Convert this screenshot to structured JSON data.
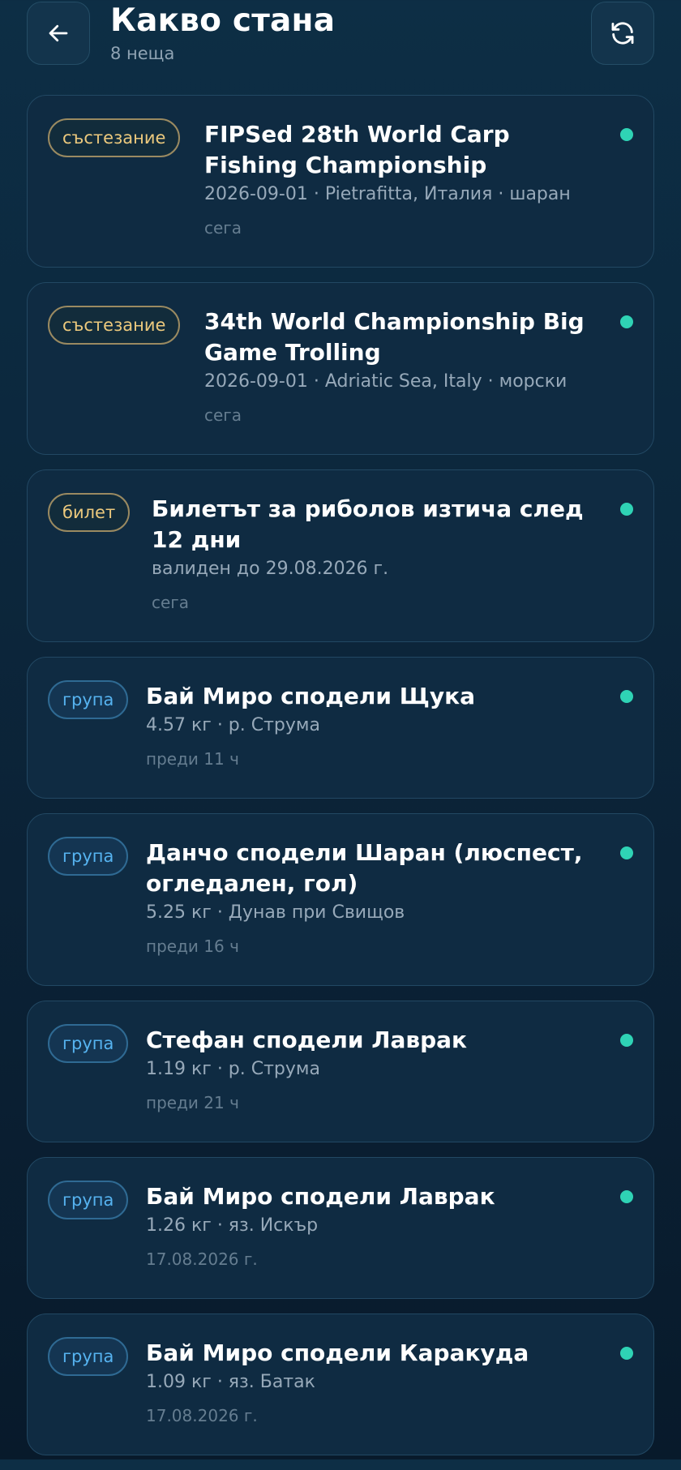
{
  "header": {
    "title": "Какво стана",
    "subtitle": "8 неща",
    "back_icon": "arrow-left-icon",
    "refresh_icon": "refresh-icon"
  },
  "colors": {
    "accent_dot": "#2fd3b5",
    "badge_competition": "#ecc97d",
    "badge_group": "#56b3f0"
  },
  "items": [
    {
      "badge": "състезание",
      "title": "FIPSed 28th World Carp Fishing Championship",
      "meta": "2026-09-01 · Pietrafitta, Италия · шаран",
      "time": "сега"
    },
    {
      "badge": "състезание",
      "title": "34th World Championship Big Game Trolling",
      "meta": "2026-09-01 · Adriatic Sea, Italy · морски",
      "time": "сега"
    },
    {
      "badge": "билет",
      "title": "Билетът за риболов изтича след 12 дни",
      "meta": "валиден до 29.08.2026 г.",
      "time": "сега"
    },
    {
      "badge": "група",
      "title": "Бай Миро сподели Щука",
      "meta": "4.57 кг · р. Струма",
      "time": "преди 11 ч"
    },
    {
      "badge": "група",
      "title": "Данчо сподели Шаран (люспест, огледален, гол)",
      "meta": "5.25 кг · Дунав при Свищов",
      "time": "преди 16 ч"
    },
    {
      "badge": "група",
      "title": "Стефан сподели Лаврак",
      "meta": "1.19 кг · р. Струма",
      "time": "преди 21 ч"
    },
    {
      "badge": "група",
      "title": "Бай Миро сподели Лаврак",
      "meta": "1.26 кг · яз. Искър",
      "time": "17.08.2026 г."
    },
    {
      "badge": "група",
      "title": "Бай Миро сподели Каракуда",
      "meta": "1.09 кг · яз. Батак",
      "time": "17.08.2026 г."
    }
  ]
}
